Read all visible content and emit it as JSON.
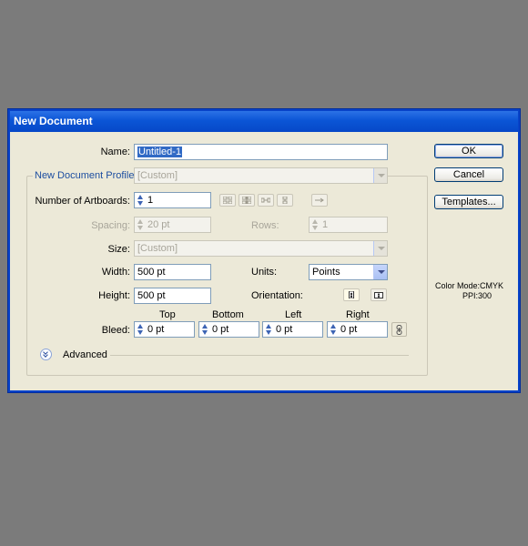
{
  "dialog": {
    "title": "New Document"
  },
  "name": {
    "label": "Name:",
    "value": "Untitled-1"
  },
  "profile": {
    "label": "New Document Profile:",
    "value": "[Custom]"
  },
  "artboards": {
    "label": "Number of Artboards:",
    "value": "1"
  },
  "spacing": {
    "label": "Spacing:",
    "value": "20 pt"
  },
  "rows": {
    "label": "Rows:",
    "value": "1"
  },
  "size": {
    "label": "Size:",
    "value": "[Custom]"
  },
  "width": {
    "label": "Width:",
    "value": "500 pt"
  },
  "units": {
    "label": "Units:",
    "value": "Points"
  },
  "height": {
    "label": "Height:",
    "value": "500 pt"
  },
  "orientation": {
    "label": "Orientation:"
  },
  "bleed": {
    "label": "Bleed:",
    "top": {
      "label": "Top",
      "value": "0 pt"
    },
    "bottom": {
      "label": "Bottom",
      "value": "0 pt"
    },
    "left": {
      "label": "Left",
      "value": "0 pt"
    },
    "right": {
      "label": "Right",
      "value": "0 pt"
    }
  },
  "advanced": {
    "label": "Advanced"
  },
  "buttons": {
    "ok": "OK",
    "cancel": "Cancel",
    "templates": "Templates..."
  },
  "info": {
    "color_mode": "Color Mode:CMYK",
    "ppi": "PPI:300"
  },
  "icons": {
    "artboard_layouts": [
      "grid-by-row-icon",
      "grid-by-column-icon",
      "arrange-by-row-icon",
      "arrange-by-column-icon"
    ],
    "direction": "right-to-left-icon",
    "orientation": [
      "portrait-icon",
      "landscape-icon"
    ],
    "bleed_link": "chain-link-icon"
  },
  "colors": {
    "title_bar": "#0b55d6",
    "dialog_bg": "#ece9d8",
    "selection": "#316ac5",
    "link_text": "#1d4ea0"
  }
}
